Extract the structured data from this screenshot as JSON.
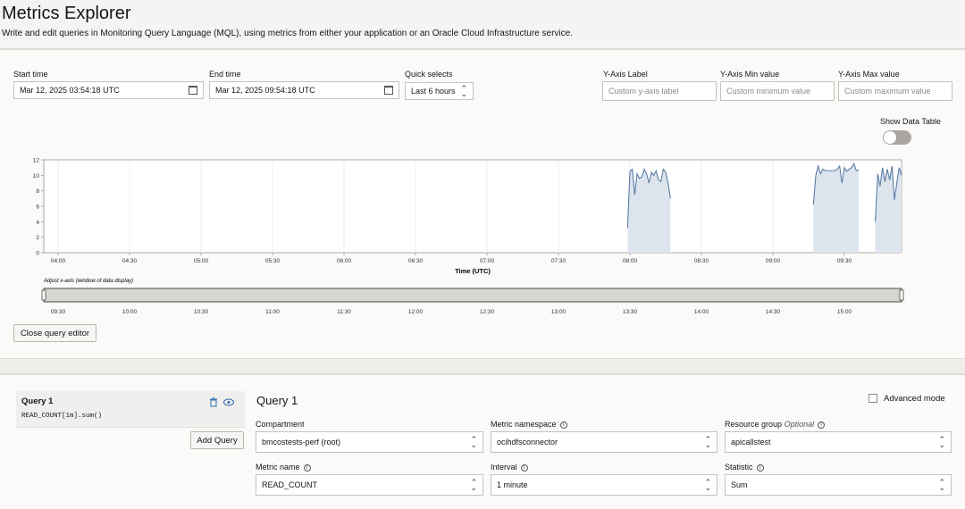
{
  "header": {
    "title": "Metrics Explorer",
    "subtitle": "Write and edit queries in Monitoring Query Language (MQL), using metrics from either your application or an Oracle Cloud Infrastructure service."
  },
  "controls": {
    "start_time_label": "Start time",
    "start_time_value": "Mar 12, 2025 03:54:18 UTC",
    "end_time_label": "End time",
    "end_time_value": "Mar 12, 2025 09:54:18 UTC",
    "quick_selects_label": "Quick selects",
    "quick_selects_value": "Last 6 hours",
    "y_axis_label_label": "Y-Axis Label",
    "y_axis_label_placeholder": "Custom y-axis label",
    "y_axis_min_label": "Y-Axis Min value",
    "y_axis_min_placeholder": "Custom minimum value",
    "y_axis_max_label": "Y-Axis Max value",
    "y_axis_max_placeholder": "Custom maximum value",
    "show_data_table_label": "Show Data Table",
    "show_data_table_on": false
  },
  "chart_data": {
    "type": "area",
    "xlabel": "Time (UTC)",
    "ylim": [
      0,
      12
    ],
    "yticks": [
      "0",
      "2",
      "4",
      "6",
      "8",
      "10",
      "12"
    ],
    "xticks": [
      "04:00",
      "04:30",
      "05:00",
      "05:30",
      "06:00",
      "06:30",
      "07:00",
      "07:30",
      "08:00",
      "08:30",
      "09:00",
      "09:30"
    ],
    "line_color": "#5a7ea6",
    "fill_color": "#dde4ee",
    "series": [
      {
        "segments": [
          [
            [
              "07:59",
              3.2
            ],
            [
              "08:00",
              10.5
            ],
            [
              "08:01",
              10.8
            ],
            [
              "08:02",
              7.5
            ],
            [
              "08:03",
              10.2
            ],
            [
              "08:04",
              9.6
            ],
            [
              "08:05",
              9.8
            ],
            [
              "08:06",
              10.8
            ],
            [
              "08:07",
              10.2
            ],
            [
              "08:08",
              9.0
            ],
            [
              "08:09",
              10.4
            ],
            [
              "08:10",
              10.0
            ],
            [
              "08:11",
              10.6
            ],
            [
              "08:12",
              9.4
            ],
            [
              "08:13",
              9.2
            ],
            [
              "08:14",
              10.8
            ],
            [
              "08:15",
              10.4
            ],
            [
              "08:16",
              9.0
            ],
            [
              "08:17",
              7.0
            ]
          ],
          [
            [
              "09:17",
              6.2
            ],
            [
              "09:18",
              10.0
            ],
            [
              "09:19",
              11.2
            ],
            [
              "09:20",
              10.2
            ],
            [
              "09:21",
              10.8
            ],
            [
              "09:22",
              10.6
            ],
            [
              "09:23",
              10.6
            ],
            [
              "09:24",
              10.6
            ],
            [
              "09:25",
              10.6
            ],
            [
              "09:26",
              10.6
            ],
            [
              "09:27",
              10.8
            ],
            [
              "09:28",
              11.2
            ],
            [
              "09:29",
              9.0
            ],
            [
              "09:30",
              11.0
            ],
            [
              "09:31",
              10.5
            ],
            [
              "09:32",
              10.8
            ],
            [
              "09:33",
              11.0
            ],
            [
              "09:34",
              11.5
            ],
            [
              "09:35",
              10.6
            ],
            [
              "09:36",
              10.7
            ]
          ],
          [
            [
              "09:43",
              4.0
            ],
            [
              "09:44",
              10.2
            ],
            [
              "09:45",
              8.6
            ],
            [
              "09:46",
              11.0
            ],
            [
              "09:47",
              9.2
            ],
            [
              "09:48",
              10.8
            ],
            [
              "09:49",
              9.4
            ],
            [
              "09:50",
              11.2
            ],
            [
              "09:51",
              6.8
            ],
            [
              "09:52",
              9.0
            ],
            [
              "09:53",
              11.0
            ],
            [
              "09:54",
              10.0
            ]
          ]
        ]
      }
    ]
  },
  "scrubber": {
    "label": "Adjust x-axis (window of data display)",
    "ticks": [
      "09:30",
      "10:00",
      "10:30",
      "11:00",
      "11:30",
      "12:00",
      "12:30",
      "13:00",
      "13:30",
      "14:00",
      "14:30",
      "15:00"
    ]
  },
  "buttons": {
    "close_editor": "Close query editor",
    "add_query": "Add Query"
  },
  "query": {
    "card_title": "Query 1",
    "card_mql": "READ_COUNT[1m].sum()",
    "heading": "Query 1",
    "advanced_mode_label": "Advanced mode",
    "compartment_label": "Compartment",
    "compartment_value": "bmcostests-perf (root)",
    "namespace_label": "Metric namespace",
    "namespace_value": "ocihdfsconnector",
    "resource_group_label": "Resource group",
    "resource_group_optional": "Optional",
    "resource_group_value": "apicallstest",
    "metric_name_label": "Metric name",
    "metric_name_value": "READ_COUNT",
    "interval_label": "Interval",
    "interval_value": "1 minute",
    "statistic_label": "Statistic",
    "statistic_value": "Sum"
  },
  "icons": {
    "calendar": "calendar-icon",
    "chevron": "select-chevron-icon",
    "trash": "trash-icon",
    "eye": "eye-icon",
    "info": "info-icon"
  }
}
